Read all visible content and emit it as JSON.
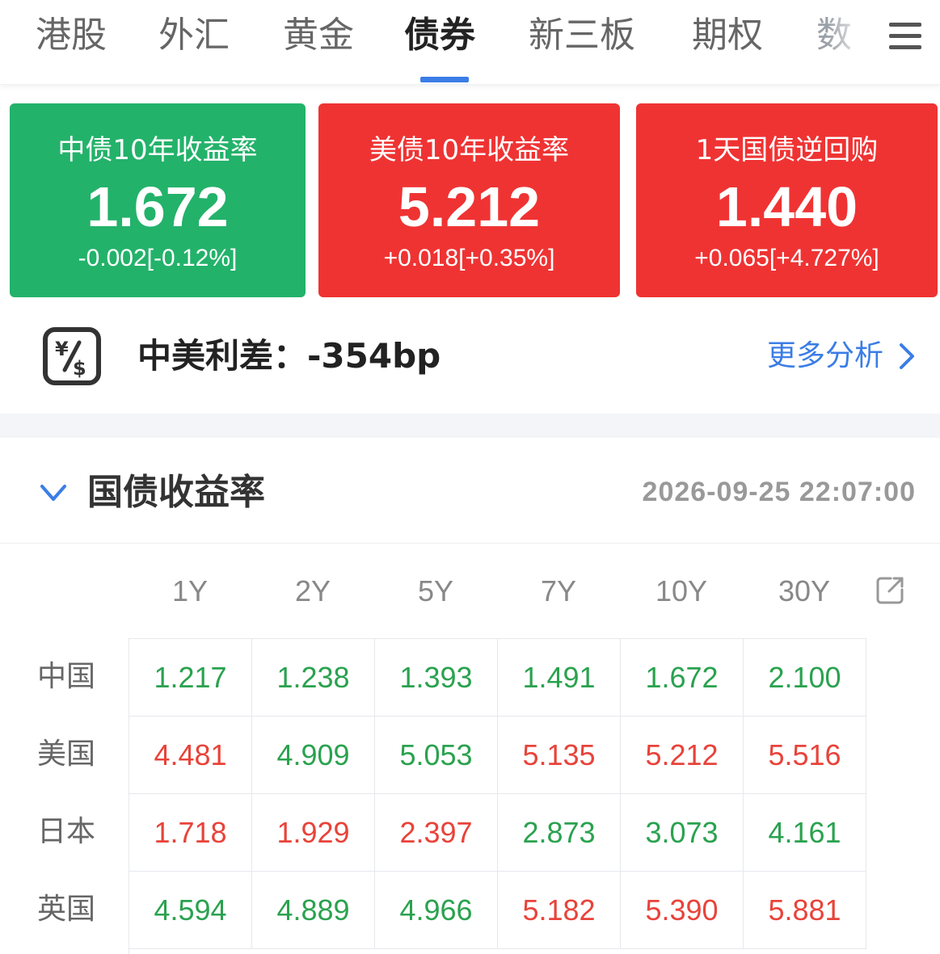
{
  "nav": {
    "tabs": [
      {
        "label": "港股",
        "state": "normal"
      },
      {
        "label": "外汇",
        "state": "normal"
      },
      {
        "label": "黄金",
        "state": "normal"
      },
      {
        "label": "债券",
        "state": "active"
      },
      {
        "label": "新三板",
        "state": "normal"
      },
      {
        "label": "期权",
        "state": "normal"
      },
      {
        "label": "数",
        "state": "clipped"
      }
    ],
    "menu_icon": "hamburger-icon",
    "accent_color": "#3b7de6"
  },
  "cards": [
    {
      "title": "中债10年收益率",
      "value": "1.672",
      "change": "-0.002[-0.12%]",
      "color": "#23b26a"
    },
    {
      "title": "美债10年收益率",
      "value": "5.212",
      "change": "+0.018[+0.35%]",
      "color": "#ef3333"
    },
    {
      "title": "1天国债逆回购",
      "value": "1.440",
      "change": "+0.065[+4.727%]",
      "color": "#ef3333"
    }
  ],
  "spread": {
    "icon": "currency-exchange-icon",
    "text": "中美利差：-354bp",
    "more_label": "更多分析",
    "more_icon": "chevron-right-icon"
  },
  "yields": {
    "collapse_icon": "chevron-down-icon",
    "title": "国债收益率",
    "timestamp": "2026-09-25 22:07:00",
    "expand_icon": "external-link-icon",
    "columns": [
      "1Y",
      "2Y",
      "5Y",
      "7Y",
      "10Y",
      "30Y"
    ],
    "rows": [
      {
        "country": "中国",
        "values": [
          "1.217",
          "1.238",
          "1.393",
          "1.491",
          "1.672",
          "2.100"
        ],
        "trend": [
          "down",
          "down",
          "down",
          "down",
          "down",
          "down"
        ]
      },
      {
        "country": "美国",
        "values": [
          "4.481",
          "4.909",
          "5.053",
          "5.135",
          "5.212",
          "5.516"
        ],
        "trend": [
          "up",
          "down",
          "down",
          "up",
          "up",
          "up"
        ]
      },
      {
        "country": "日本",
        "values": [
          "1.718",
          "1.929",
          "2.397",
          "2.873",
          "3.073",
          "4.161"
        ],
        "trend": [
          "up",
          "up",
          "up",
          "down",
          "down",
          "down"
        ]
      },
      {
        "country": "英国",
        "values": [
          "4.594",
          "4.889",
          "4.966",
          "5.182",
          "5.390",
          "5.881"
        ],
        "trend": [
          "down",
          "down",
          "down",
          "up",
          "up",
          "up"
        ]
      }
    ],
    "up_color": "#e8433a",
    "down_color": "#2aa24f"
  }
}
